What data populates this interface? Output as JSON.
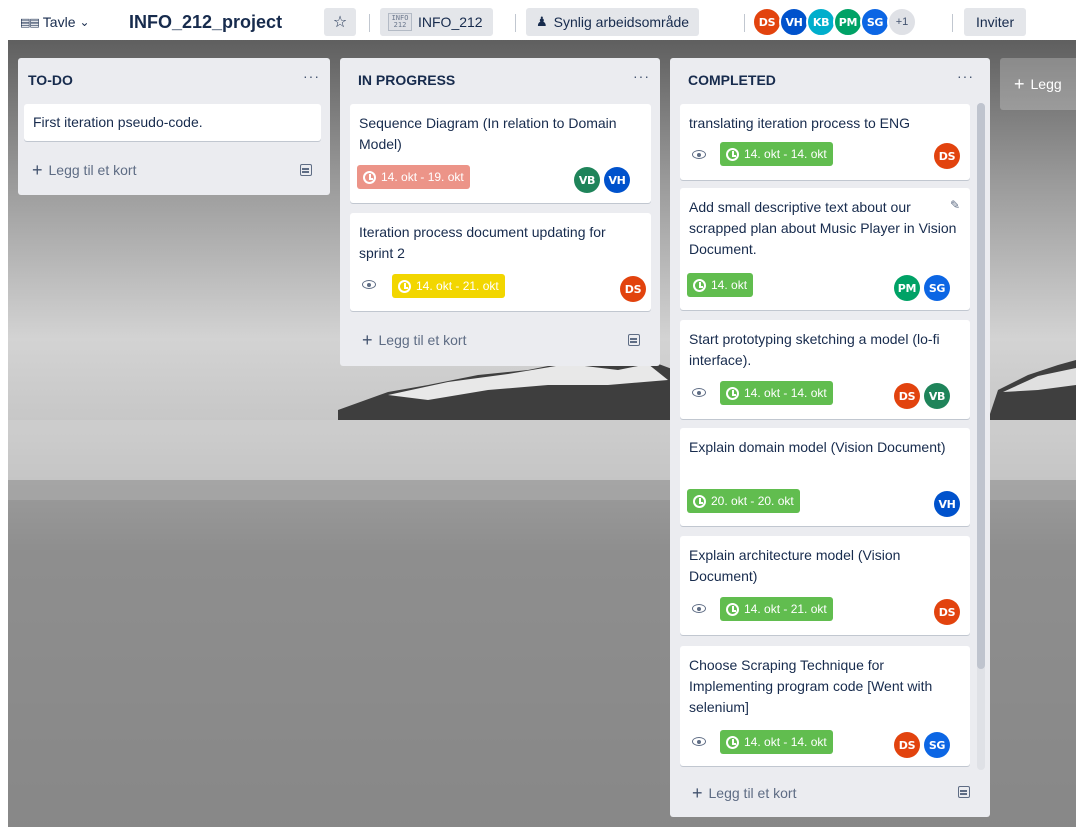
{
  "header": {
    "board_switch_label": "Tavle",
    "board_title": "INFO_212_project",
    "workspace_logo_text": "INFO 212",
    "workspace_label": "INFO_212",
    "visibility_label": "Synlig arbeidsområde",
    "members": [
      {
        "initials": "DS",
        "color": "#e2430e"
      },
      {
        "initials": "VH",
        "color": "#0052cc"
      },
      {
        "initials": "KB",
        "color": "#00aecc"
      },
      {
        "initials": "PM",
        "color": "#00a266"
      },
      {
        "initials": "SG",
        "color": "#0c66e4"
      }
    ],
    "more_members": "+1",
    "invite_label": "Inviter"
  },
  "lists": {
    "todo": {
      "title": "TO-DO",
      "menu": "···",
      "cards": [
        {
          "title": "First iteration pseudo-code."
        }
      ],
      "add_card": "Legg til et kort"
    },
    "in_progress": {
      "title": "IN PROGRESS",
      "menu": "···",
      "cards": [
        {
          "title": "Sequence Diagram (In relation to Domain Model)",
          "date": "14. okt - 19. okt",
          "members": [
            "VB",
            "VH"
          ]
        },
        {
          "title": "Iteration process document updating for sprint 2",
          "date": "14. okt - 21. okt",
          "members": [
            "DS"
          ]
        }
      ],
      "add_card": "Legg til et kort"
    },
    "completed": {
      "title": "COMPLETED",
      "menu": "···",
      "cards": [
        {
          "title": "translating iteration process to ENG",
          "date": "14. okt - 14. okt",
          "members": [
            "DS"
          ]
        },
        {
          "title": "Add small descriptive text about our scrapped plan about Music Player in Vision Document.",
          "date": "14. okt",
          "members": [
            "PM",
            "SG"
          ]
        },
        {
          "title": "Start prototyping sketching a model (lo-fi interface).",
          "date": "14. okt - 14. okt",
          "members": [
            "DS",
            "VB"
          ]
        },
        {
          "title": "Explain domain model (Vision Document)",
          "date": "20. okt - 20. okt",
          "members": [
            "VH"
          ]
        },
        {
          "title": "Explain architecture model (Vision Document)",
          "date": "14. okt - 21. okt",
          "members": [
            "DS"
          ]
        },
        {
          "title": "Choose Scraping Technique for Implementing program code [Went with selenium]",
          "date": "14. okt - 14. okt",
          "members": [
            "DS",
            "SG"
          ]
        }
      ],
      "add_card": "Legg til et kort"
    }
  },
  "add_list_label": "Legg",
  "colors": {
    "due_complete": "#61bd4f",
    "due_soon": "#f2d600",
    "overdue": "#ec9488",
    "list_bg": "#ebecf0"
  }
}
